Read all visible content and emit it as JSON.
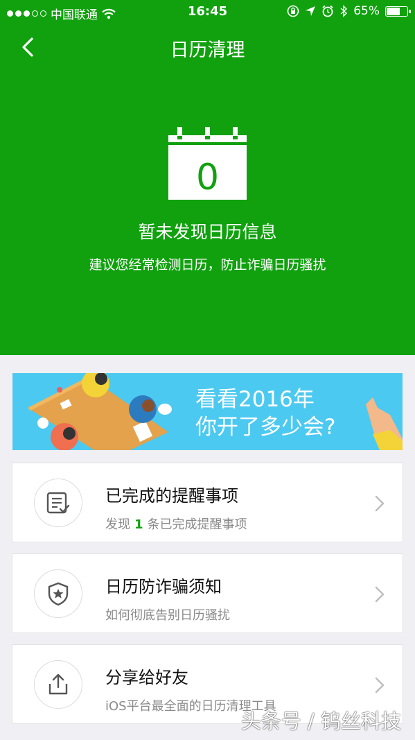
{
  "status_bar": {
    "carrier": "中国联通",
    "time": "16:45",
    "battery_percent": "65%",
    "battery_level": 0.65,
    "icons": [
      "signal-dots-icon",
      "wifi-icon",
      "orientation-lock-icon",
      "location-icon",
      "alarm-icon",
      "bluetooth-icon",
      "battery-icon"
    ]
  },
  "nav": {
    "title": "日历清理",
    "back_icon": "chevron-left-icon"
  },
  "empty_state": {
    "count": "0",
    "title": "暂未发现日历信息",
    "subtitle": "建议您经常检测日历，防止诈骗日历骚扰"
  },
  "banner": {
    "line1": "看看2016年",
    "line2": "你开了多少会?"
  },
  "cards": [
    {
      "title": "已完成的提醒事项",
      "sub_prefix": "发现",
      "sub_count": "1",
      "sub_suffix": "条已完成提醒事项",
      "icon": "checklist-icon"
    },
    {
      "title": "日历防诈骗须知",
      "subtitle": "如何彻底告别日历骚扰",
      "icon": "shield-star-icon"
    },
    {
      "title": "分享给好友",
      "subtitle": "iOS平台最全面的日历清理工具",
      "icon": "share-icon"
    }
  ],
  "watermark": "头条号 / 钨丝科技",
  "colors": {
    "primary_green": "#11a10f",
    "background": "#efeff4",
    "banner_blue": "#4cc9f0"
  }
}
